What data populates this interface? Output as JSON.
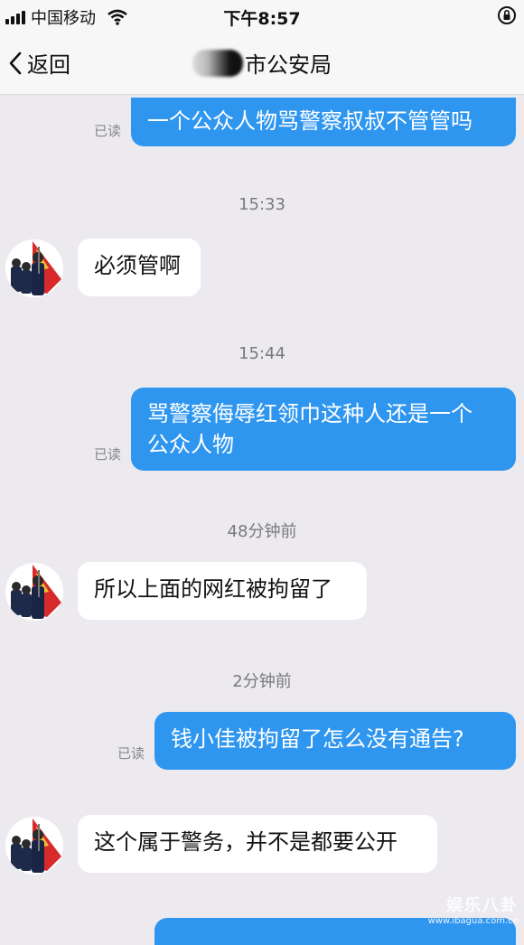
{
  "status_bar": {
    "carrier": "中国移动",
    "time": "下午8:57"
  },
  "nav": {
    "back_label": "返回",
    "title": "市公安局"
  },
  "messages": {
    "m1": {
      "text": "一个公众人物骂警察叔叔不管管吗",
      "read": "已读"
    },
    "t1": "15:33",
    "m2": {
      "text": "必须管啊"
    },
    "t2": "15:44",
    "m3": {
      "line1": "骂警察侮辱红领巾这种人还是一个",
      "line2": "公众人物",
      "read": "已读"
    },
    "t3": "48分钟前",
    "m4": {
      "text": "所以上面的网红被拘留了"
    },
    "t4": "2分钟前",
    "m5": {
      "text": "钱小佳被拘留了怎么没有通告?",
      "read": "已读"
    },
    "m6": {
      "text": "这个属于警务，并不是都要公开"
    }
  },
  "watermark": {
    "text": "娱乐八卦",
    "url": "www.ibagua.com.cn"
  },
  "colors": {
    "outgoing_bubble": "#2f96f0",
    "incoming_bubble": "#ffffff",
    "background": "#eceaee"
  }
}
